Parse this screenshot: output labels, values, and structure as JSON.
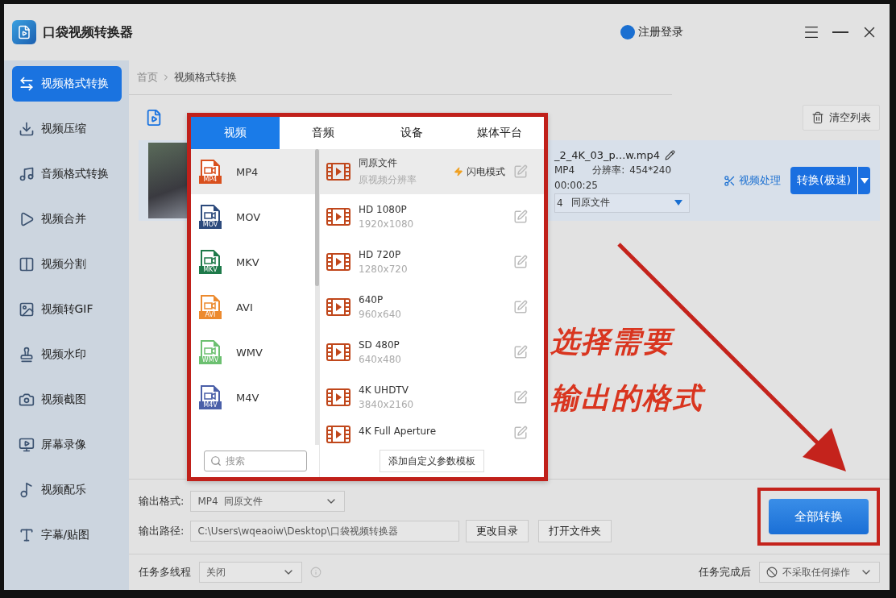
{
  "app": {
    "title": "口袋视频转换器",
    "login": "注册登录"
  },
  "sidebar": {
    "items": [
      {
        "label": "视频格式转换",
        "selected": true
      },
      {
        "label": "视频压缩",
        "selected": false
      },
      {
        "label": "音频格式转换",
        "selected": false
      },
      {
        "label": "视频合并",
        "selected": false
      },
      {
        "label": "视频分割",
        "selected": false
      },
      {
        "label": "视频转GIF",
        "selected": false
      },
      {
        "label": "视频水印",
        "selected": false
      },
      {
        "label": "视频截图",
        "selected": false
      },
      {
        "label": "屏幕录像",
        "selected": false
      },
      {
        "label": "视频配乐",
        "selected": false
      },
      {
        "label": "字幕/贴图",
        "selected": false
      }
    ]
  },
  "breadcrumb": [
    "首页",
    "视频格式转换"
  ],
  "toolbar": {
    "clear_button": "清空列表"
  },
  "file": {
    "name": "_2_4K_03_p...w.mp4",
    "format": "MP4",
    "resolution_label": "分辨率:",
    "resolution": "454*240",
    "duration": "00:00:25",
    "preset_format": "4",
    "preset": "同原文件",
    "edit_link": "视频处理",
    "convert_button": "转换(极速)"
  },
  "format_popup": {
    "tabs": [
      {
        "label": "视频",
        "selected": true
      },
      {
        "label": "音频",
        "selected": false
      },
      {
        "label": "设备",
        "selected": false
      },
      {
        "label": "媒体平台",
        "selected": false
      }
    ],
    "formats": [
      {
        "label": "MP4",
        "badge": "MP4",
        "color": "#d9501e",
        "selected": true
      },
      {
        "label": "MOV",
        "badge": "MOV",
        "color": "#2c4a7c",
        "selected": false
      },
      {
        "label": "MKV",
        "badge": "MKV",
        "color": "#1e7a4a",
        "selected": false
      },
      {
        "label": "AVI",
        "badge": "AVI",
        "color": "#ec8a2e",
        "selected": false
      },
      {
        "label": "WMV",
        "badge": "WMV",
        "color": "#6cc070",
        "selected": false
      },
      {
        "label": "M4V",
        "badge": "M4V",
        "color": "#4a5fa8",
        "selected": false
      }
    ],
    "presets": [
      {
        "title": "同原文件",
        "subtitle": "原视频分辨率",
        "badge": "闪电模式",
        "selected": true
      },
      {
        "title": "HD 1080P",
        "subtitle": "1920x1080",
        "selected": false
      },
      {
        "title": "HD 720P",
        "subtitle": "1280x720",
        "selected": false
      },
      {
        "title": "640P",
        "subtitle": "960x640",
        "selected": false
      },
      {
        "title": "SD 480P",
        "subtitle": "640x480",
        "selected": false
      },
      {
        "title": "4K UHDTV",
        "subtitle": "3840x2160",
        "selected": false
      },
      {
        "title": "4K Full Aperture",
        "selected": false
      }
    ],
    "search": {
      "placeholder": "搜索"
    },
    "add_template_button": "添加自定义参数模板"
  },
  "annotation": {
    "lines": [
      "选择需要",
      "输出的格式"
    ]
  },
  "output": {
    "format_label": "输出格式:",
    "format_value": "MP4  同原文件",
    "path_label": "输出路径:",
    "path_value": "C:\\Users\\wqeaoiw\\Desktop\\口袋视频转换器",
    "change_dir_button": "更改目录",
    "open_folder_button": "打开文件夹",
    "convert_all_button": "全部转换"
  },
  "footer": {
    "threads_label": "任务多线程",
    "threads_value": "关闭",
    "after_label": "任务完成后",
    "after_value": "不采取任何操作"
  }
}
